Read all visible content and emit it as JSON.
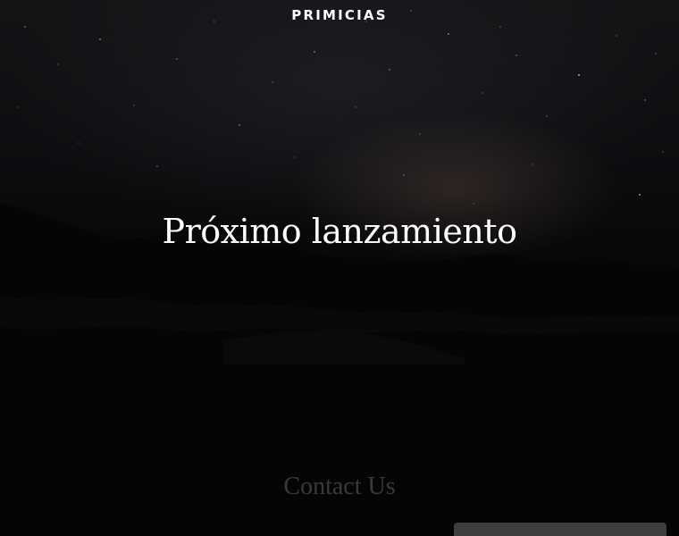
{
  "header": {
    "brand": "PRIMICIAS"
  },
  "hero": {
    "title": "Próximo lanzamiento"
  },
  "contact": {
    "title": "Contact Us"
  }
}
